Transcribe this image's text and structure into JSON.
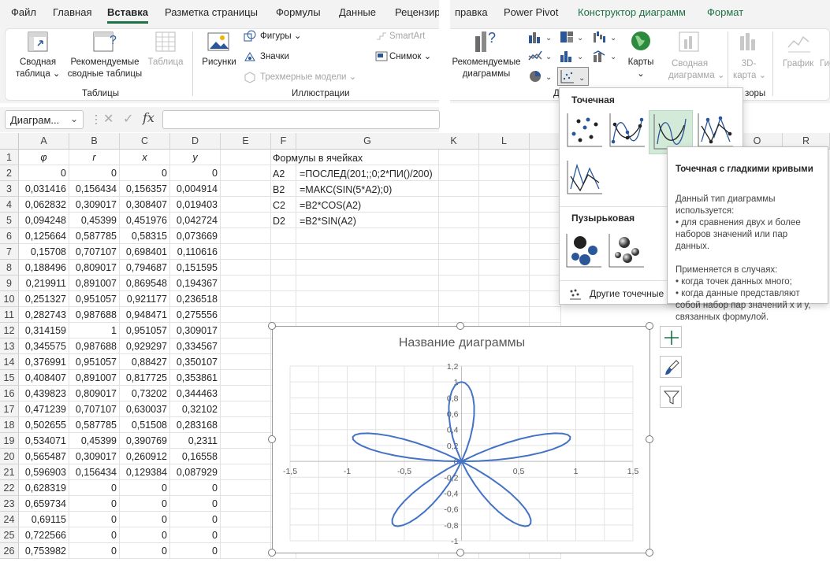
{
  "menu": {
    "tabs": [
      "Файл",
      "Главная",
      "Вставка",
      "Разметка страницы",
      "Формулы",
      "Данные",
      "Рецензир",
      "правка",
      "Power Pivot",
      "Конструктор диаграмм",
      "Формат"
    ],
    "active_tab": "Вставка"
  },
  "ribbon": {
    "tables": {
      "pivot_line1": "Сводная",
      "pivot_line2": "таблица",
      "recommended_line1": "Рекомендуемые",
      "recommended_line2": "сводные таблицы",
      "table": "Таблица",
      "group": "Таблицы"
    },
    "illustrations": {
      "pictures": "Рисунки",
      "shapes": "Фигуры",
      "icons": "Значки",
      "models3d": "Трехмерные модели",
      "smartart": "SmartArt",
      "snapshot": "Снимок",
      "group": "Иллюстрации"
    },
    "charts": {
      "recommended_line1": "Рекомендуемые",
      "recommended_line2": "диаграммы",
      "maps": "Карты",
      "pivotchart_line1": "Сводная",
      "pivotchart_line2": "диаграмма",
      "map3d_line1": "3D-",
      "map3d_line2": "карта",
      "group_partial": "Д",
      "tours_partial": "зоры",
      "sparkline_line": "График",
      "sparkline_col": "Гис"
    }
  },
  "formula_bar": {
    "name_box": "Диаграм...",
    "fx_label": "fx",
    "formula": ""
  },
  "grid": {
    "columns": [
      "A",
      "B",
      "C",
      "D",
      "E",
      "F",
      "G",
      "K",
      "L",
      "M",
      "O",
      "R"
    ],
    "rows": [
      "1",
      "2",
      "3",
      "4",
      "5",
      "6",
      "7",
      "8",
      "9",
      "10",
      "11",
      "12",
      "13",
      "14",
      "15",
      "16",
      "17",
      "18",
      "19",
      "20",
      "21",
      "22",
      "23",
      "24",
      "25",
      "26"
    ],
    "headers": [
      "φ",
      "r",
      "x",
      "y"
    ],
    "data": [
      [
        "0",
        "0",
        "0",
        "0"
      ],
      [
        "0,031416",
        "0,156434",
        "0,156357",
        "0,004914"
      ],
      [
        "0,062832",
        "0,309017",
        "0,308407",
        "0,019403"
      ],
      [
        "0,094248",
        "0,45399",
        "0,451976",
        "0,042724"
      ],
      [
        "0,125664",
        "0,587785",
        "0,58315",
        "0,073669"
      ],
      [
        "0,15708",
        "0,707107",
        "0,698401",
        "0,110616"
      ],
      [
        "0,188496",
        "0,809017",
        "0,794687",
        "0,151595"
      ],
      [
        "0,219911",
        "0,891007",
        "0,869548",
        "0,194367"
      ],
      [
        "0,251327",
        "0,951057",
        "0,921177",
        "0,236518"
      ],
      [
        "0,282743",
        "0,987688",
        "0,948471",
        "0,275556"
      ],
      [
        "0,314159",
        "1",
        "0,951057",
        "0,309017"
      ],
      [
        "0,345575",
        "0,987688",
        "0,929297",
        "0,334567"
      ],
      [
        "0,376991",
        "0,951057",
        "0,88427",
        "0,350107"
      ],
      [
        "0,408407",
        "0,891007",
        "0,817725",
        "0,353861"
      ],
      [
        "0,439823",
        "0,809017",
        "0,73202",
        "0,344463"
      ],
      [
        "0,471239",
        "0,707107",
        "0,630037",
        "0,32102"
      ],
      [
        "0,502655",
        "0,587785",
        "0,51508",
        "0,283168"
      ],
      [
        "0,534071",
        "0,45399",
        "0,390769",
        "0,2311"
      ],
      [
        "0,565487",
        "0,309017",
        "0,260912",
        "0,16558"
      ],
      [
        "0,596903",
        "0,156434",
        "0,129384",
        "0,087929"
      ],
      [
        "0,628319",
        "0",
        "0",
        "0"
      ],
      [
        "0,659734",
        "0",
        "0",
        "0"
      ],
      [
        "0,69115",
        "0",
        "0",
        "0"
      ],
      [
        "0,722566",
        "0",
        "0",
        "0"
      ],
      [
        "0,753982",
        "0",
        "0",
        "0"
      ]
    ],
    "formulas_title": "Формулы в ячейках",
    "formulas": [
      {
        "cell": "A2",
        "formula": "=ПОСЛЕД(201;;0;2*ПИ()/200)"
      },
      {
        "cell": "B2",
        "formula": "=МАКС(SIN(5*A2);0)"
      },
      {
        "cell": "C2",
        "formula": "=B2*COS(A2)"
      },
      {
        "cell": "D2",
        "formula": "=B2*SIN(A2)"
      }
    ]
  },
  "dropdown": {
    "scatter_section": "Точечная",
    "bubble_section": "Пузырьковая",
    "more": "Другие точечные"
  },
  "tooltip": {
    "title": "Точечная с гладкими кривыми",
    "body": "Данный тип диаграммы используется:\n• для сравнения двух и более наборов значений или пар данных.\n\nПрименяется в случаях:\n• когда точек данных много;\n• когда данные представляют собой набор пар значений x и y, связанных формулой."
  },
  "chart_data": {
    "type": "scatter",
    "title": "Название диаграммы",
    "curve": "r = max(sin(5φ), 0); x = r·cos(φ); y = r·sin(φ); φ from 0 to 2π, 201 points",
    "xlim": [
      -1.5,
      1.5
    ],
    "ylim": [
      -1,
      1.2
    ],
    "x_ticks": [
      "-1,5",
      "-1",
      "-0,5",
      "0",
      "0,5",
      "1",
      "1,5"
    ],
    "y_ticks": [
      "1,2",
      "1",
      "0,8",
      "0,6",
      "0,4",
      "0,2",
      "0",
      "-0,2",
      "-0,4",
      "-0,6",
      "-0,8",
      "-1"
    ],
    "series_color": "#4472c4",
    "grid": true
  },
  "colors": {
    "accent_green": "#1e7145",
    "series_blue": "#4472c4"
  }
}
